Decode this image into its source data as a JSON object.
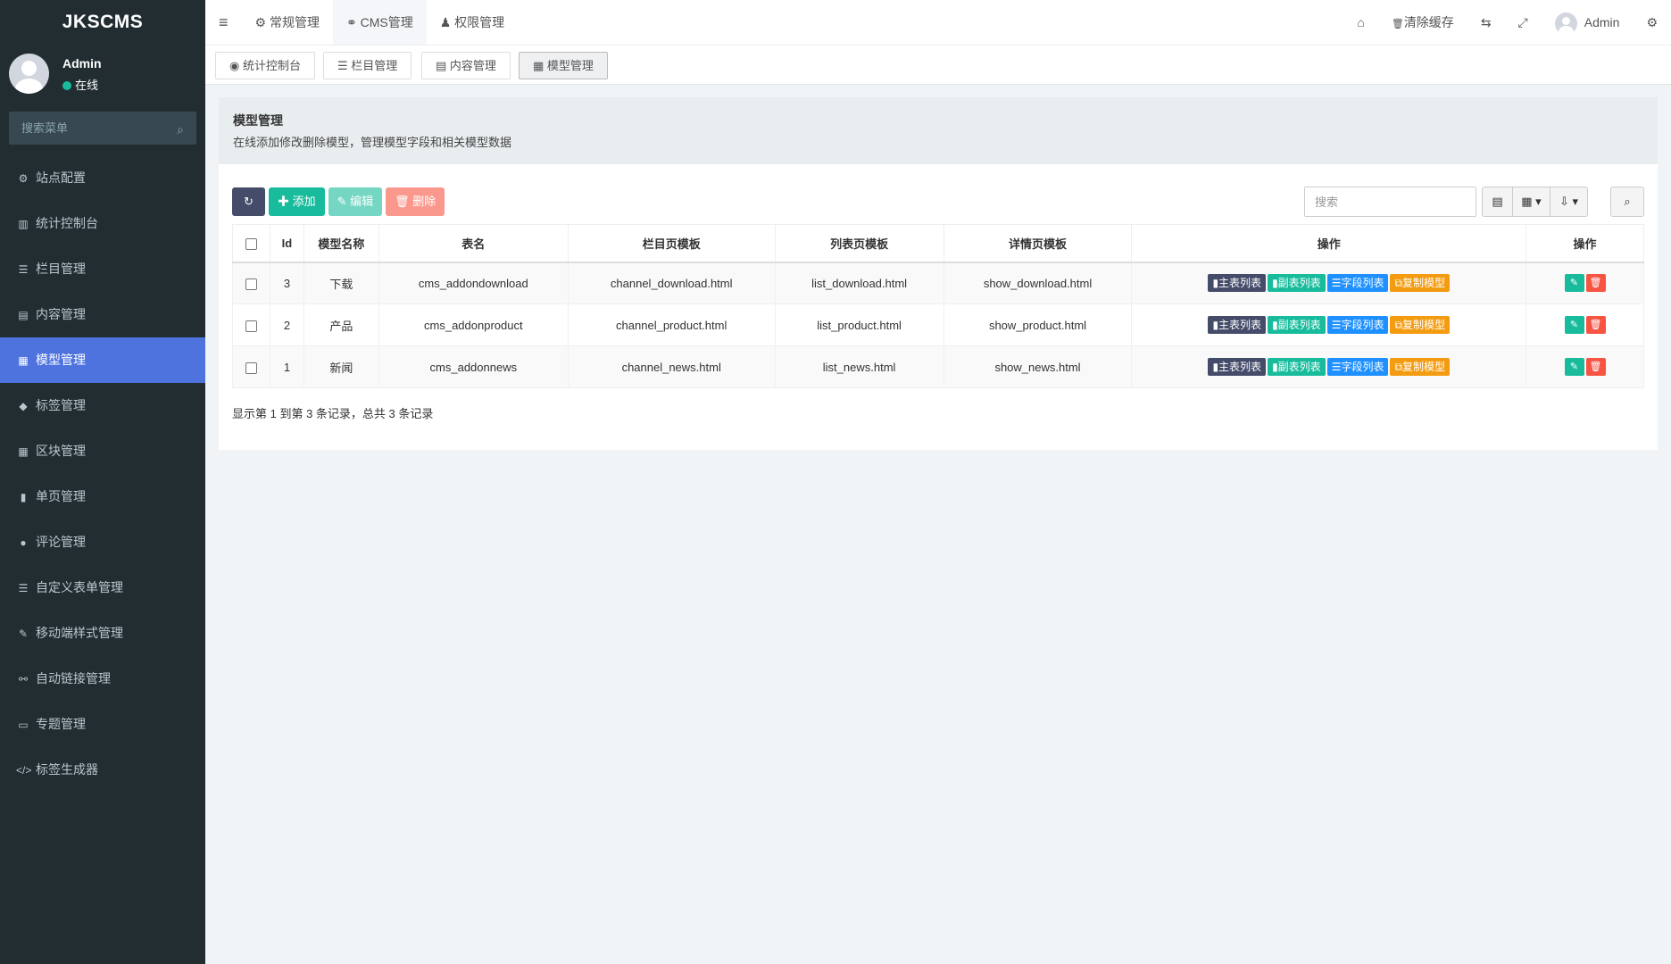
{
  "app": {
    "logo": "JKSCMS"
  },
  "user": {
    "name": "Admin",
    "status": "在线"
  },
  "sidebar": {
    "search_placeholder": "搜索菜单",
    "items": [
      {
        "label": "站点配置",
        "icon": "⚙"
      },
      {
        "label": "统计控制台",
        "icon": "▥"
      },
      {
        "label": "栏目管理",
        "icon": "☰"
      },
      {
        "label": "内容管理",
        "icon": "▤"
      },
      {
        "label": "模型管理",
        "icon": "▦"
      },
      {
        "label": "标签管理",
        "icon": "◆"
      },
      {
        "label": "区块管理",
        "icon": "▦"
      },
      {
        "label": "单页管理",
        "icon": "▮"
      },
      {
        "label": "评论管理",
        "icon": "●"
      },
      {
        "label": "自定义表单管理",
        "icon": "☰"
      },
      {
        "label": "移动端样式管理",
        "icon": "✎"
      },
      {
        "label": "自动链接管理",
        "icon": "⚯"
      },
      {
        "label": "专题管理",
        "icon": "▭"
      },
      {
        "label": "标签生成器",
        "icon": "</>"
      }
    ]
  },
  "navbar": {
    "toggle": "≡",
    "items": [
      {
        "label": "常规管理",
        "icon": "⚙"
      },
      {
        "label": "CMS管理",
        "icon": "⚭"
      },
      {
        "label": "权限管理",
        "icon": "♟"
      }
    ],
    "right": {
      "home": "⌂",
      "clear_cache": "清除缓存",
      "trash": "🗑",
      "lang": "⇆",
      "fullscreen": "⤢",
      "user": "Admin",
      "settings": "⚙"
    }
  },
  "tabs": [
    {
      "label": "统计控制台",
      "icon": "◉"
    },
    {
      "label": "栏目管理",
      "icon": "☰"
    },
    {
      "label": "内容管理",
      "icon": "▤"
    },
    {
      "label": "模型管理",
      "icon": "▦"
    }
  ],
  "panel": {
    "title": "模型管理",
    "description": "在线添加修改删除模型，管理模型字段和相关模型数据"
  },
  "toolbar": {
    "refresh": "↻",
    "add": "✚ 添加",
    "edit": "✎ 编辑",
    "delete": "🗑 删除"
  },
  "table_tools": {
    "search_placeholder": "搜索",
    "toggle_view": "▤",
    "columns": "▦ ▾",
    "export": "⇩ ▾",
    "search_icon": "⌕"
  },
  "table": {
    "headers": [
      "Id",
      "模型名称",
      "表名",
      "栏目页模板",
      "列表页模板",
      "详情页模板",
      "操作",
      "操作"
    ],
    "rows": [
      {
        "id": "3",
        "name": "下载",
        "table": "cms_addondownload",
        "channel": "channel_download.html",
        "list": "list_download.html",
        "show": "show_download.html"
      },
      {
        "id": "2",
        "name": "产品",
        "table": "cms_addonproduct",
        "channel": "channel_product.html",
        "list": "list_product.html",
        "show": "show_product.html"
      },
      {
        "id": "1",
        "name": "新闻",
        "table": "cms_addonnews",
        "channel": "channel_news.html",
        "list": "list_news.html",
        "show": "show_news.html"
      }
    ],
    "row_actions": {
      "main": "主表列表",
      "sub": "副表列表",
      "fields": "字段列表",
      "copy": "复制模型",
      "edit": "✎",
      "delete": "🗑"
    }
  },
  "pagination": {
    "info": "显示第 1 到第 3 条记录，总共 3 条记录"
  }
}
